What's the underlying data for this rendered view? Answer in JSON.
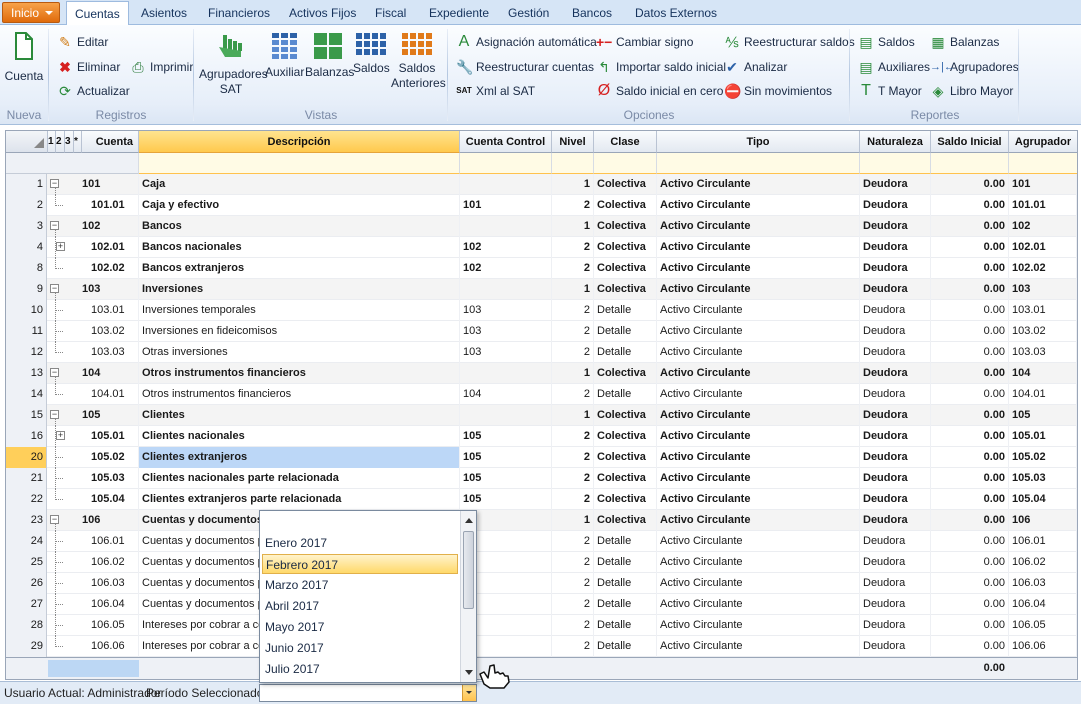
{
  "tabs": {
    "inicio": "Inicio",
    "items": [
      "Cuentas",
      "Asientos",
      "Financieros",
      "Activos Fijos",
      "Fiscal",
      "Expediente",
      "Gestión",
      "Bancos",
      "Datos Externos"
    ]
  },
  "ribbon": {
    "nueva": {
      "cuenta": "Cuenta",
      "label": "Nueva"
    },
    "registros": {
      "editar": "Editar",
      "eliminar": "Eliminar",
      "actualizar": "Actualizar",
      "imprimir": "Imprimir",
      "label": "Registros"
    },
    "vistas": {
      "agrupadores_sat_1": "Agrupadores",
      "agrupadores_sat_2": "SAT",
      "auxiliar": "Auxiliar",
      "balanzas": "Balanzas",
      "saldos": "Saldos",
      "saldos_ant_1": "Saldos",
      "saldos_ant_2": "Anteriores",
      "label": "Vistas"
    },
    "opciones": {
      "asignacion": "Asignación automática",
      "reestructurar_cuentas": "Reestructurar cuentas",
      "xml_sat": "Xml al SAT",
      "cambiar_signo": "Cambiar signo",
      "importar_saldo": "Importar saldo inicial",
      "saldo_cero": "Saldo inicial en cero",
      "reestructurar_saldos": "Reestructurar saldos",
      "analizar": "Analizar",
      "sin_movimientos": "Sin movimientos",
      "label": "Opciones"
    },
    "reportes": {
      "saldos": "Saldos",
      "auxiliares": "Auxiliares",
      "tmayor": "T Mayor",
      "balanzas": "Balanzas",
      "agrupadores": "Agrupadores",
      "libro_mayor": "Libro Mayor",
      "label": "Reportes"
    }
  },
  "grid": {
    "levels": [
      "1",
      "2",
      "3",
      "*"
    ],
    "headers": {
      "cuenta": "Cuenta",
      "descripcion": "Descripción",
      "cuenta_control": "Cuenta Control",
      "nivel": "Nivel",
      "clase": "Clase",
      "tipo": "Tipo",
      "naturaleza": "Naturaleza",
      "saldo_inicial": "Saldo Inicial",
      "agrupador": "Agrupador"
    },
    "rows": [
      {
        "n": "1",
        "cuenta": "101",
        "desc": "Caja",
        "ctrl": "",
        "nivel": "1",
        "clase": "Colectiva",
        "tipo": "Activo Circulante",
        "nat": "Deudora",
        "saldo": "0.00",
        "agr": "101"
      },
      {
        "n": "2",
        "cuenta": "101.01",
        "desc": "Caja y efectivo",
        "ctrl": "101",
        "nivel": "2",
        "clase": "Colectiva",
        "tipo": "Activo Circulante",
        "nat": "Deudora",
        "saldo": "0.00",
        "agr": "101.01"
      },
      {
        "n": "3",
        "cuenta": "102",
        "desc": "Bancos",
        "ctrl": "",
        "nivel": "1",
        "clase": "Colectiva",
        "tipo": "Activo Circulante",
        "nat": "Deudora",
        "saldo": "0.00",
        "agr": "102"
      },
      {
        "n": "4",
        "cuenta": "102.01",
        "desc": "Bancos nacionales",
        "ctrl": "102",
        "nivel": "2",
        "clase": "Colectiva",
        "tipo": "Activo Circulante",
        "nat": "Deudora",
        "saldo": "0.00",
        "agr": "102.01"
      },
      {
        "n": "8",
        "cuenta": "102.02",
        "desc": "Bancos extranjeros",
        "ctrl": "102",
        "nivel": "2",
        "clase": "Colectiva",
        "tipo": "Activo Circulante",
        "nat": "Deudora",
        "saldo": "0.00",
        "agr": "102.02"
      },
      {
        "n": "9",
        "cuenta": "103",
        "desc": "Inversiones",
        "ctrl": "",
        "nivel": "1",
        "clase": "Colectiva",
        "tipo": "Activo Circulante",
        "nat": "Deudora",
        "saldo": "0.00",
        "agr": "103"
      },
      {
        "n": "10",
        "cuenta": "103.01",
        "desc": "Inversiones temporales",
        "ctrl": "103",
        "nivel": "2",
        "clase": "Detalle",
        "tipo": "Activo Circulante",
        "nat": "Deudora",
        "saldo": "0.00",
        "agr": "103.01"
      },
      {
        "n": "11",
        "cuenta": "103.02",
        "desc": "Inversiones en fideicomisos",
        "ctrl": "103",
        "nivel": "2",
        "clase": "Detalle",
        "tipo": "Activo Circulante",
        "nat": "Deudora",
        "saldo": "0.00",
        "agr": "103.02"
      },
      {
        "n": "12",
        "cuenta": "103.03",
        "desc": "Otras inversiones",
        "ctrl": "103",
        "nivel": "2",
        "clase": "Detalle",
        "tipo": "Activo Circulante",
        "nat": "Deudora",
        "saldo": "0.00",
        "agr": "103.03"
      },
      {
        "n": "13",
        "cuenta": "104",
        "desc": "Otros instrumentos financieros",
        "ctrl": "",
        "nivel": "1",
        "clase": "Colectiva",
        "tipo": "Activo Circulante",
        "nat": "Deudora",
        "saldo": "0.00",
        "agr": "104"
      },
      {
        "n": "14",
        "cuenta": "104.01",
        "desc": "Otros instrumentos financieros",
        "ctrl": "104",
        "nivel": "2",
        "clase": "Detalle",
        "tipo": "Activo Circulante",
        "nat": "Deudora",
        "saldo": "0.00",
        "agr": "104.01"
      },
      {
        "n": "15",
        "cuenta": "105",
        "desc": "Clientes",
        "ctrl": "",
        "nivel": "1",
        "clase": "Colectiva",
        "tipo": "Activo Circulante",
        "nat": "Deudora",
        "saldo": "0.00",
        "agr": "105"
      },
      {
        "n": "16",
        "cuenta": "105.01",
        "desc": "Clientes nacionales",
        "ctrl": "105",
        "nivel": "2",
        "clase": "Colectiva",
        "tipo": "Activo Circulante",
        "nat": "Deudora",
        "saldo": "0.00",
        "agr": "105.01"
      },
      {
        "n": "20",
        "cuenta": "105.02",
        "desc": "Clientes extranjeros",
        "ctrl": "105",
        "nivel": "2",
        "clase": "Colectiva",
        "tipo": "Activo Circulante",
        "nat": "Deudora",
        "saldo": "0.00",
        "agr": "105.02"
      },
      {
        "n": "21",
        "cuenta": "105.03",
        "desc": "Clientes nacionales parte relacionada",
        "ctrl": "105",
        "nivel": "2",
        "clase": "Colectiva",
        "tipo": "Activo Circulante",
        "nat": "Deudora",
        "saldo": "0.00",
        "agr": "105.03"
      },
      {
        "n": "22",
        "cuenta": "105.04",
        "desc": "Clientes extranjeros parte relacionada",
        "ctrl": "105",
        "nivel": "2",
        "clase": "Colectiva",
        "tipo": "Activo Circulante",
        "nat": "Deudora",
        "saldo": "0.00",
        "agr": "105.04"
      },
      {
        "n": "23",
        "cuenta": "106",
        "desc": "Cuentas y documentos",
        "ctrl": "",
        "nivel": "1",
        "clase": "Colectiva",
        "tipo": "Activo Circulante",
        "nat": "Deudora",
        "saldo": "0.00",
        "agr": "106"
      },
      {
        "n": "24",
        "cuenta": "106.01",
        "desc": "Cuentas y documentos p",
        "ctrl": "6",
        "nivel": "2",
        "clase": "Detalle",
        "tipo": "Activo Circulante",
        "nat": "Deudora",
        "saldo": "0.00",
        "agr": "106.01"
      },
      {
        "n": "25",
        "cuenta": "106.02",
        "desc": "Cuentas y documentos p",
        "ctrl": "6",
        "nivel": "2",
        "clase": "Detalle",
        "tipo": "Activo Circulante",
        "nat": "Deudora",
        "saldo": "0.00",
        "agr": "106.02"
      },
      {
        "n": "26",
        "cuenta": "106.03",
        "desc": "Cuentas y documentos p",
        "ctrl": "6",
        "nivel": "2",
        "clase": "Detalle",
        "tipo": "Activo Circulante",
        "nat": "Deudora",
        "saldo": "0.00",
        "agr": "106.03"
      },
      {
        "n": "27",
        "cuenta": "106.04",
        "desc": "Cuentas y documentos p",
        "ctrl": "6",
        "nivel": "2",
        "clase": "Detalle",
        "tipo": "Activo Circulante",
        "nat": "Deudora",
        "saldo": "0.00",
        "agr": "106.04"
      },
      {
        "n": "28",
        "cuenta": "106.05",
        "desc": "Intereses por cobrar a co",
        "ctrl": "6",
        "nivel": "2",
        "clase": "Detalle",
        "tipo": "Activo Circulante",
        "nat": "Deudora",
        "saldo": "0.00",
        "agr": "106.05"
      },
      {
        "n": "29",
        "cuenta": "106.06",
        "desc": "Intereses por cobrar a co",
        "ctrl": "6",
        "nivel": "2",
        "clase": "Detalle",
        "tipo": "Activo Circulante",
        "nat": "Deudora",
        "saldo": "0.00",
        "agr": "106.06"
      }
    ],
    "footer_total": "0.00"
  },
  "status": {
    "usuario": "Usuario Actual: Administrador",
    "periodo_label": "Período Seleccionado:"
  },
  "periodo_dropdown": {
    "options": [
      "Enero 2017",
      "Febrero 2017",
      "Marzo 2017",
      "Abril 2017",
      "Mayo 2017",
      "Junio 2017",
      "Julio 2017"
    ],
    "highlighted": "Febrero 2017"
  }
}
